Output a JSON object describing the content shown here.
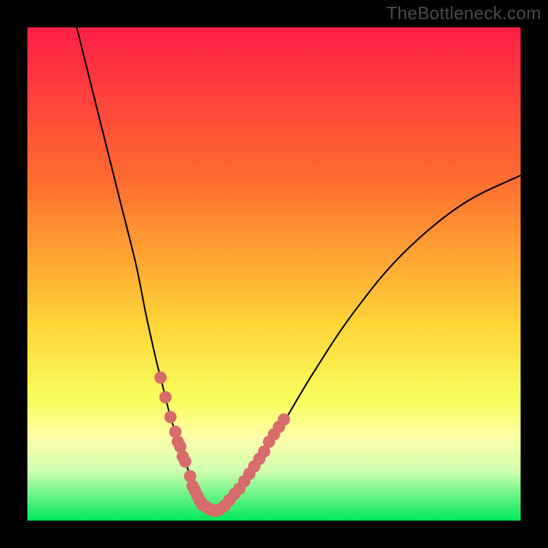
{
  "watermark": {
    "text": "TheBottleneck.com"
  },
  "colors": {
    "frame": "#000000",
    "watermark": "#4a4a4a",
    "gradient_top": "#ff1f47",
    "gradient_mid1": "#ff6a2f",
    "gradient_mid2": "#ffd437",
    "gradient_low": "#f8ff60",
    "gradient_pale": "#ffffa8",
    "gradient_band": "#cfffb0",
    "gradient_bottom": "#00e85b",
    "curve": "#000000",
    "marker": "#d86b6b"
  },
  "chart_data": {
    "type": "line",
    "title": "",
    "xlabel": "",
    "ylabel": "",
    "xlim": [
      0,
      100
    ],
    "ylim": [
      0,
      100
    ],
    "grid": false,
    "legend": false,
    "note": "Axes unlabeled; x is horizontal position (0–100 left→right), y is bottleneck magnitude (0–100 bottom→top). Values estimated from pixel positions.",
    "series": [
      {
        "name": "bottleneck-curve",
        "x": [
          10,
          13,
          16,
          19,
          22,
          24,
          26,
          27,
          28,
          29,
          30,
          31,
          32,
          33,
          34,
          35,
          36,
          37,
          38,
          40,
          43,
          47,
          52,
          58,
          66,
          76,
          88,
          100
        ],
        "y": [
          100,
          88,
          76,
          64,
          52,
          42,
          33,
          29,
          25,
          21,
          18,
          15,
          12,
          9,
          6,
          4,
          3,
          2,
          2,
          3,
          6,
          12,
          20,
          30,
          42,
          54,
          64,
          70
        ]
      }
    ],
    "markers": {
      "name": "highlight-dots",
      "note": "Dense pink dot clusters along the curve near its minimum and on both flanks within the pale/green band (roughly y=2–18).",
      "points": [
        {
          "x": 27,
          "y": 29
        },
        {
          "x": 28,
          "y": 25
        },
        {
          "x": 29,
          "y": 21
        },
        {
          "x": 30,
          "y": 18
        },
        {
          "x": 30.5,
          "y": 16
        },
        {
          "x": 31,
          "y": 15
        },
        {
          "x": 31.5,
          "y": 13
        },
        {
          "x": 32,
          "y": 12
        },
        {
          "x": 33,
          "y": 9
        },
        {
          "x": 33.5,
          "y": 7
        },
        {
          "x": 34,
          "y": 6
        },
        {
          "x": 34.5,
          "y": 5
        },
        {
          "x": 35,
          "y": 4
        },
        {
          "x": 35.5,
          "y": 3.2
        },
        {
          "x": 36,
          "y": 3
        },
        {
          "x": 36.5,
          "y": 2.6
        },
        {
          "x": 37,
          "y": 2.3
        },
        {
          "x": 37.5,
          "y": 2.1
        },
        {
          "x": 38,
          "y": 2
        },
        {
          "x": 38.5,
          "y": 2.1
        },
        {
          "x": 39,
          "y": 2.3
        },
        {
          "x": 40,
          "y": 3
        },
        {
          "x": 41,
          "y": 4.2
        },
        {
          "x": 42,
          "y": 5.4
        },
        {
          "x": 43,
          "y": 6.5
        },
        {
          "x": 44,
          "y": 8
        },
        {
          "x": 45,
          "y": 9.5
        },
        {
          "x": 46,
          "y": 11
        },
        {
          "x": 47,
          "y": 12.5
        },
        {
          "x": 48,
          "y": 14
        },
        {
          "x": 49,
          "y": 16
        },
        {
          "x": 50,
          "y": 17.5
        },
        {
          "x": 51,
          "y": 19
        },
        {
          "x": 52,
          "y": 20.5
        }
      ]
    },
    "background_gradient": {
      "type": "vertical-linear",
      "stops": [
        {
          "pos": 0.0,
          "color": "#ff1f47"
        },
        {
          "pos": 0.3,
          "color": "#ff6a2f"
        },
        {
          "pos": 0.6,
          "color": "#ffd437"
        },
        {
          "pos": 0.76,
          "color": "#f8ff60"
        },
        {
          "pos": 0.83,
          "color": "#ffffa8"
        },
        {
          "pos": 0.9,
          "color": "#cfffb0"
        },
        {
          "pos": 1.0,
          "color": "#00e85b"
        }
      ]
    }
  }
}
